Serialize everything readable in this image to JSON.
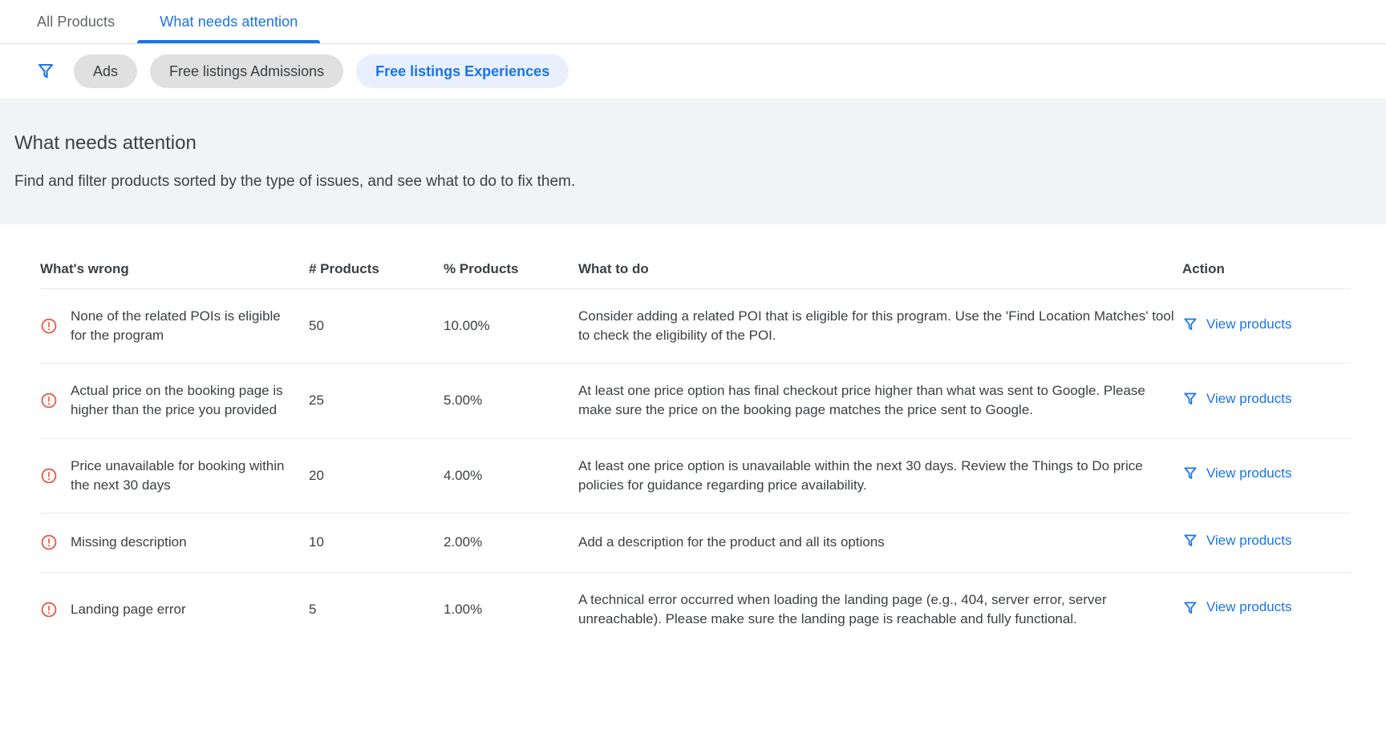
{
  "tabs": [
    {
      "label": "All Products",
      "active": false
    },
    {
      "label": "What needs attention",
      "active": true
    }
  ],
  "filter_bar": {
    "icon": "filter-icon",
    "chips": [
      {
        "label": "Ads",
        "selected": false
      },
      {
        "label": "Free listings Admissions",
        "selected": false
      },
      {
        "label": "Free listings Experiences",
        "selected": true
      }
    ]
  },
  "banner": {
    "title": "What needs attention",
    "subtitle": "Find and filter products sorted by the type of issues, and see what to do to fix them."
  },
  "table": {
    "columns": [
      "What's wrong",
      "# Products",
      "% Products",
      "What to do",
      "Action"
    ],
    "action_label": "View products",
    "action_icon": "filter-icon",
    "row_icon": "error-circle-icon",
    "rows": [
      {
        "whats_wrong": "None of the related POIs is eligible for the program",
        "num_products": "50",
        "pct_products": "10.00%",
        "what_to_do": "Consider adding a related POI that is eligible for this program. Use the 'Find Location Matches' tool to check the eligibility of the POI.",
        "action": "View products"
      },
      {
        "whats_wrong": "Actual price on the booking page is higher than the price you provided",
        "num_products": "25",
        "pct_products": "5.00%",
        "what_to_do": "At least one price option has final checkout price higher than what was sent to Google. Please make sure the price on the booking page matches the price sent to Google.",
        "action": "View products"
      },
      {
        "whats_wrong": "Price unavailable for booking within the next 30 days",
        "num_products": "20",
        "pct_products": "4.00%",
        "what_to_do": "At least one price option is unavailable within the next 30 days. Review the Things to Do price policies for guidance regarding price availability.",
        "action": "View products"
      },
      {
        "whats_wrong": "Missing description",
        "num_products": "10",
        "pct_products": "2.00%",
        "what_to_do": "Add a description for the product and all its options",
        "action": "View products"
      },
      {
        "whats_wrong": "Landing page error",
        "num_products": "5",
        "pct_products": "1.00%",
        "what_to_do": "A technical error occurred when loading the landing page (e.g., 404, server error, server unreachable). Please make sure the landing page is reachable and fully functional.",
        "action": "View products"
      }
    ]
  },
  "colors": {
    "accent_blue": "#1a73e8",
    "chip_selected_bg": "#e8f0fe",
    "chip_bg": "#e0e0e0",
    "error_red": "#e8543f",
    "banner_bg": "#f1f3f4",
    "text": "#3c4043"
  }
}
